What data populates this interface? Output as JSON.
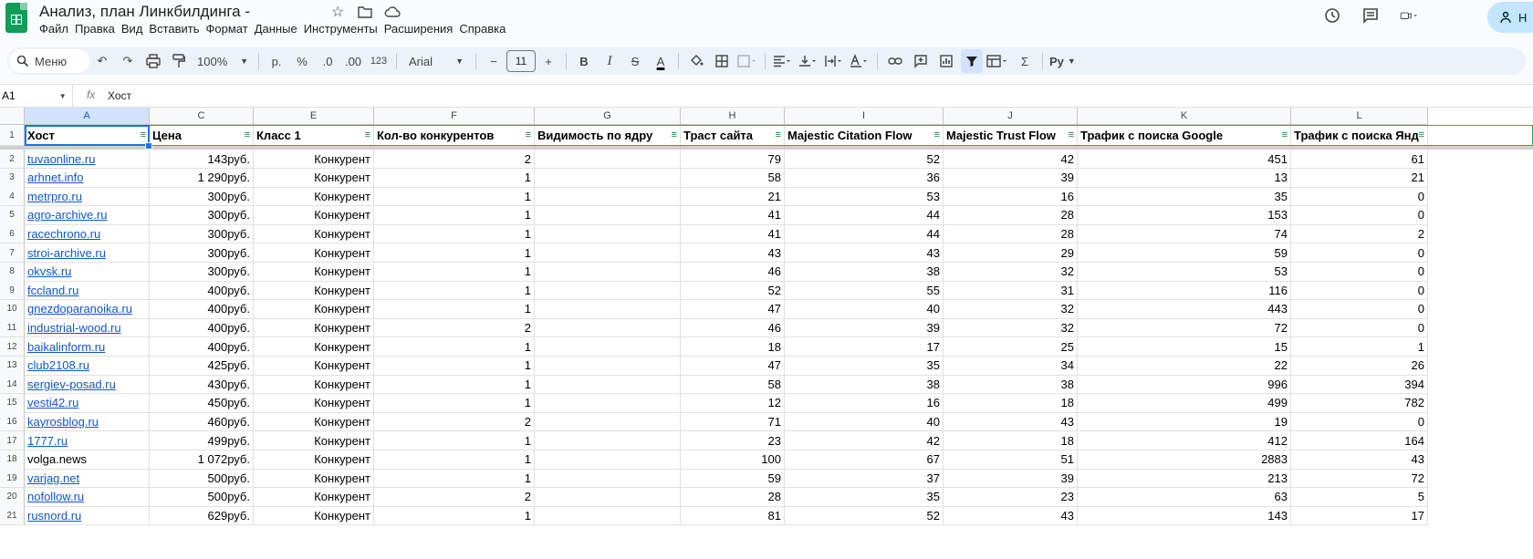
{
  "app": {
    "title": "Анализ, план Линкбилдинга -",
    "menus": [
      "Файл",
      "Правка",
      "Вид",
      "Вставить",
      "Формат",
      "Данные",
      "Инструменты",
      "Расширения",
      "Справка"
    ],
    "share_label": "Н"
  },
  "toolbar": {
    "search_label": "Меню",
    "zoom": "100%",
    "currency": "р.",
    "percent": "%",
    "dec_minus": ".0",
    "dec_plus": ".00",
    "format_123": "123",
    "font": "Arial",
    "font_size": "11",
    "bold": "B",
    "italic": "I",
    "strike": "S",
    "text_color": "A",
    "sum": "Σ",
    "input_tools": "Ру"
  },
  "formula_bar": {
    "cell_ref": "A1",
    "fx": "fx",
    "value": "Хост"
  },
  "columns": [
    "A",
    "C",
    "E",
    "F",
    "G",
    "H",
    "I",
    "J",
    "K",
    "L"
  ],
  "headers": [
    "Хост",
    "Цена",
    "Класс 1",
    "Кол-во конкурентов",
    "Видимость по ядру",
    "Траст сайта",
    "Majestic Citation Flow",
    "Majestic Trust Flow",
    "Трафик с поиска Google",
    "Трафик с поиска Янд"
  ],
  "rows": [
    {
      "num": "2",
      "host": "tuvaonline.ru",
      "link": true,
      "price": "143руб.",
      "cls": "Конкурент",
      "comp": "2",
      "vis": "",
      "trust": "79",
      "cf": "52",
      "tf": "42",
      "google": "451",
      "yandex": "61"
    },
    {
      "num": "3",
      "host": "arhnet.info",
      "link": true,
      "price": "1 290руб.",
      "cls": "Конкурент",
      "comp": "1",
      "vis": "",
      "trust": "58",
      "cf": "36",
      "tf": "39",
      "google": "13",
      "yandex": "21"
    },
    {
      "num": "4",
      "host": "metrpro.ru",
      "link": true,
      "price": "300руб.",
      "cls": "Конкурент",
      "comp": "1",
      "vis": "",
      "trust": "21",
      "cf": "53",
      "tf": "16",
      "google": "35",
      "yandex": "0"
    },
    {
      "num": "5",
      "host": "agro-archive.ru",
      "link": true,
      "price": "300руб.",
      "cls": "Конкурент",
      "comp": "1",
      "vis": "",
      "trust": "41",
      "cf": "44",
      "tf": "28",
      "google": "153",
      "yandex": "0"
    },
    {
      "num": "6",
      "host": "racechrono.ru",
      "link": true,
      "price": "300руб.",
      "cls": "Конкурент",
      "comp": "1",
      "vis": "",
      "trust": "41",
      "cf": "44",
      "tf": "28",
      "google": "74",
      "yandex": "2"
    },
    {
      "num": "7",
      "host": "stroi-archive.ru",
      "link": true,
      "price": "300руб.",
      "cls": "Конкурент",
      "comp": "1",
      "vis": "",
      "trust": "43",
      "cf": "43",
      "tf": "29",
      "google": "59",
      "yandex": "0"
    },
    {
      "num": "8",
      "host": "okvsk.ru",
      "link": true,
      "price": "300руб.",
      "cls": "Конкурент",
      "comp": "1",
      "vis": "",
      "trust": "46",
      "cf": "38",
      "tf": "32",
      "google": "53",
      "yandex": "0"
    },
    {
      "num": "9",
      "host": "fccland.ru",
      "link": true,
      "price": "400руб.",
      "cls": "Конкурент",
      "comp": "1",
      "vis": "",
      "trust": "52",
      "cf": "55",
      "tf": "31",
      "google": "116",
      "yandex": "0"
    },
    {
      "num": "10",
      "host": "gnezdoparanoika.ru",
      "link": true,
      "price": "400руб.",
      "cls": "Конкурент",
      "comp": "1",
      "vis": "",
      "trust": "47",
      "cf": "40",
      "tf": "32",
      "google": "443",
      "yandex": "0"
    },
    {
      "num": "11",
      "host": "industrial-wood.ru",
      "link": true,
      "price": "400руб.",
      "cls": "Конкурент",
      "comp": "2",
      "vis": "",
      "trust": "46",
      "cf": "39",
      "tf": "32",
      "google": "72",
      "yandex": "0"
    },
    {
      "num": "12",
      "host": "baikalinform.ru",
      "link": true,
      "price": "400руб.",
      "cls": "Конкурент",
      "comp": "1",
      "vis": "",
      "trust": "18",
      "cf": "17",
      "tf": "25",
      "google": "15",
      "yandex": "1"
    },
    {
      "num": "13",
      "host": "club2108.ru",
      "link": true,
      "price": "425руб.",
      "cls": "Конкурент",
      "comp": "1",
      "vis": "",
      "trust": "47",
      "cf": "35",
      "tf": "34",
      "google": "22",
      "yandex": "26"
    },
    {
      "num": "14",
      "host": "sergiev-posad.ru",
      "link": true,
      "price": "430руб.",
      "cls": "Конкурент",
      "comp": "1",
      "vis": "",
      "trust": "58",
      "cf": "38",
      "tf": "38",
      "google": "996",
      "yandex": "394"
    },
    {
      "num": "15",
      "host": "vesti42.ru",
      "link": true,
      "price": "450руб.",
      "cls": "Конкурент",
      "comp": "1",
      "vis": "",
      "trust": "12",
      "cf": "16",
      "tf": "18",
      "google": "499",
      "yandex": "782"
    },
    {
      "num": "16",
      "host": "kayrosblog.ru",
      "link": true,
      "price": "460руб.",
      "cls": "Конкурент",
      "comp": "2",
      "vis": "",
      "trust": "71",
      "cf": "40",
      "tf": "43",
      "google": "19",
      "yandex": "0"
    },
    {
      "num": "17",
      "host": "1777.ru",
      "link": true,
      "price": "499руб.",
      "cls": "Конкурент",
      "comp": "1",
      "vis": "",
      "trust": "23",
      "cf": "42",
      "tf": "18",
      "google": "412",
      "yandex": "164"
    },
    {
      "num": "18",
      "host": "volga.news",
      "link": false,
      "price": "1 072руб.",
      "cls": "Конкурент",
      "comp": "1",
      "vis": "",
      "trust": "100",
      "cf": "67",
      "tf": "51",
      "google": "2883",
      "yandex": "43"
    },
    {
      "num": "19",
      "host": "varjag.net",
      "link": true,
      "price": "500руб.",
      "cls": "Конкурент",
      "comp": "1",
      "vis": "",
      "trust": "59",
      "cf": "37",
      "tf": "39",
      "google": "213",
      "yandex": "72"
    },
    {
      "num": "20",
      "host": "nofollow.ru",
      "link": true,
      "price": "500руб.",
      "cls": "Конкурент",
      "comp": "2",
      "vis": "",
      "trust": "28",
      "cf": "35",
      "tf": "23",
      "google": "63",
      "yandex": "5"
    },
    {
      "num": "21",
      "host": "rusnord.ru",
      "link": true,
      "price": "629руб.",
      "cls": "Конкурент",
      "comp": "1",
      "vis": "",
      "trust": "81",
      "cf": "52",
      "tf": "43",
      "google": "143",
      "yandex": "17"
    }
  ]
}
